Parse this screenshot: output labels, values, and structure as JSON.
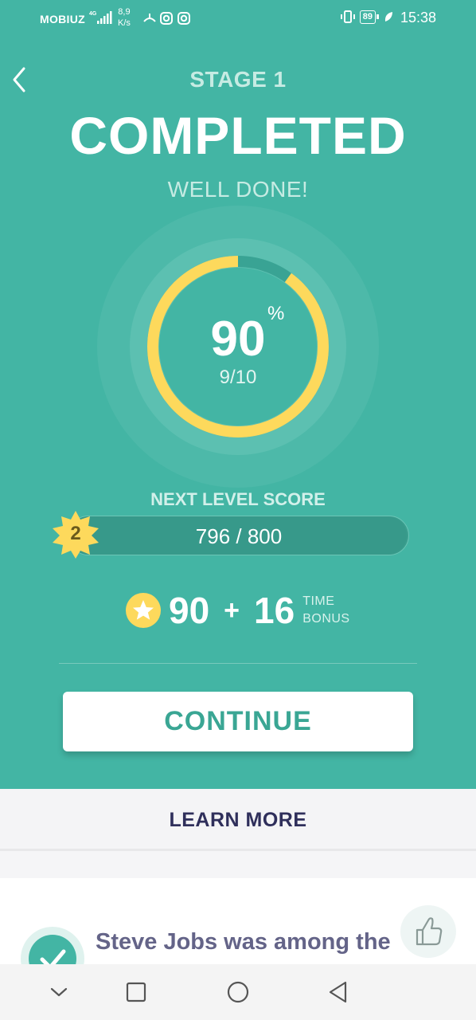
{
  "status_bar": {
    "carrier": "MOBIUZ",
    "network": "4G",
    "speed_value": "8,9",
    "speed_unit": "K/s",
    "battery": "89",
    "time": "15:38"
  },
  "header": {
    "stage": "STAGE 1",
    "title": "COMPLETED",
    "subtitle": "WELL DONE!"
  },
  "result": {
    "percent": "90",
    "percent_sign": "%",
    "fraction": "9/10",
    "progress_ratio": 0.9
  },
  "next_level": {
    "title": "NEXT LEVEL SCORE",
    "level": "2",
    "progress_text": "796 / 800",
    "current": 796,
    "target": 800
  },
  "score": {
    "points": "90",
    "plus": "+",
    "bonus": "16",
    "bonus_label_1": "TIME",
    "bonus_label_2": "BONUS"
  },
  "actions": {
    "continue": "CONTINUE",
    "learn_more": "LEARN MORE"
  },
  "fact": {
    "text": "Steve Jobs was among the founders of this"
  },
  "colors": {
    "teal": "#43b5a4",
    "ring": "#fdd95c",
    "dark_teal": "#37998a",
    "learn_text": "#2f2f5b"
  },
  "icons": {
    "back": "chevron-left-icon",
    "star": "star-icon",
    "check": "check-icon",
    "thumb": "thumbs-up-icon"
  }
}
